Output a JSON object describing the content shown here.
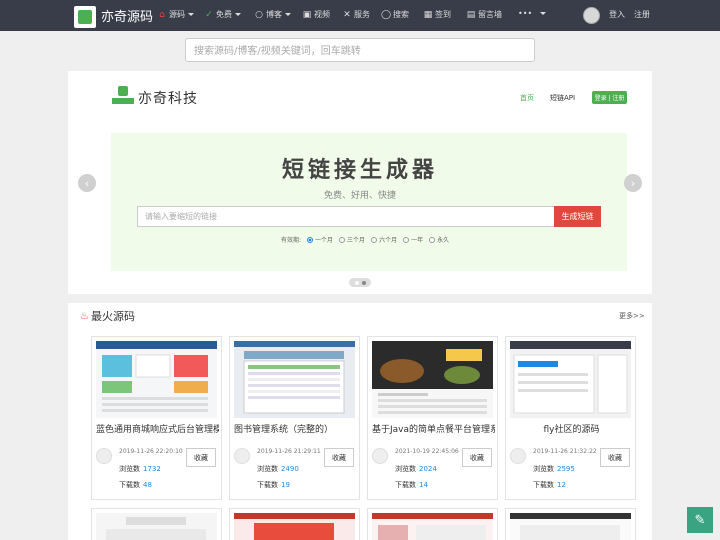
{
  "topnav": {
    "site_title": "亦奇源码",
    "items": [
      "源码",
      "免费",
      "博客",
      "视频",
      "服务",
      "搜索",
      "签到",
      "留言墙",
      "•••"
    ],
    "login": "登入",
    "register": "注册"
  },
  "search": {
    "placeholder": "搜索源码/博客/视频关键词，回车跳转"
  },
  "banner": {
    "brand": "亦奇科技",
    "nav_home": "首页",
    "nav_api": "短链API",
    "login_register": "登录 | 注册",
    "hero_title": "短链接生成器",
    "hero_sub": "免费、好用、快捷",
    "link_placeholder": "请输入要缩短的链接",
    "generate": "生成短链",
    "validity_label": "有效期:",
    "validity_options": [
      "一个月",
      "三个月",
      "六个月",
      "一年",
      "永久"
    ],
    "validity_selected": 0
  },
  "hot": {
    "title": "最火源码",
    "more": "更多>>",
    "view_label": "浏览数",
    "download_label": "下载数",
    "fav_label": "收藏",
    "cards": [
      {
        "title": "蓝色通用商城响应式后台管理模板",
        "date": "2019-11-26 22:20:10",
        "views": "1732",
        "downloads": "48"
      },
      {
        "title": "图书管理系统（完整的）",
        "date": "2019-11-26 21:29:11",
        "views": "2490",
        "downloads": "19"
      },
      {
        "title": "基于Java的简单点餐平台管理系统",
        "date": "2021-10-19 22:45:06",
        "views": "2024",
        "downloads": "14"
      },
      {
        "title": "fly社区的源码",
        "date": "2019-11-26 21:32:22",
        "views": "2595",
        "downloads": "12"
      }
    ]
  },
  "colors": {
    "nav_bg": "#393d49",
    "green": "#4caf50",
    "red": "#e2473b",
    "link_blue": "#1e88e5",
    "fab": "#3aa381"
  }
}
